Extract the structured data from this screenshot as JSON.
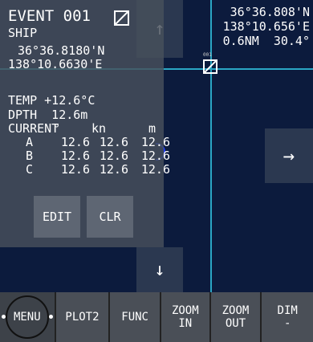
{
  "readout": {
    "lat": "36°36.808'N",
    "lon": "138°10.656'E",
    "range": "0.6NM",
    "bearing": "30.4°"
  },
  "map": {
    "up_arrow": "↑",
    "right_arrow": "→",
    "down_arrow": "↓",
    "marker_label": "001"
  },
  "event_panel": {
    "title": "EVENT 001",
    "ship_label": "SHIP",
    "lat": "36°36.8180'N",
    "lon": "138°10.6630'E",
    "temp": "TEMP +12.6°C",
    "depth": "DPTH  12.6m",
    "current": {
      "label": "CURRENT",
      "headers": [
        "°",
        "kn",
        "m"
      ],
      "rows": [
        {
          "name": "A",
          "deg": "12.6",
          "kn": "12.6",
          "m": "12.6"
        },
        {
          "name": "B",
          "deg": "12.6",
          "kn": "12.6",
          "m": "12.6"
        },
        {
          "name": "C",
          "deg": "12.6",
          "kn": "12.6",
          "m": "12.6"
        }
      ]
    },
    "edit_label": "EDIT",
    "clr_label": "CLR"
  },
  "toolbar": {
    "menu": "MENU",
    "plot2": "PLOT2",
    "func": "FUNC",
    "zoom_in_1": "ZOOM",
    "zoom_in_2": "IN",
    "zoom_out_1": "ZOOM",
    "zoom_out_2": "OUT",
    "dim_1": "DIM",
    "dim_2": "-"
  }
}
